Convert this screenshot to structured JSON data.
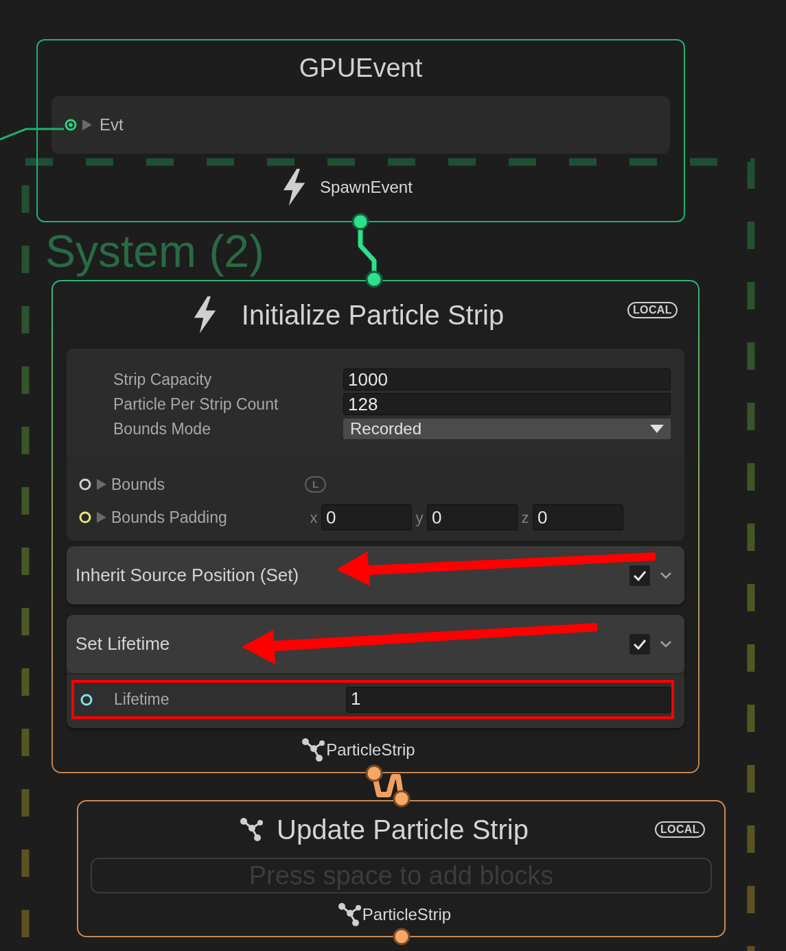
{
  "system": {
    "title": "System (2)"
  },
  "gpu_event": {
    "title": "GPUEvent",
    "ports": [
      {
        "label": "Evt",
        "color": "#2bd47f"
      }
    ],
    "output": "SpawnEvent"
  },
  "initialize": {
    "title": "Initialize Particle Strip",
    "badge": "LOCAL",
    "settings": [
      {
        "label": "Strip Capacity",
        "value": "1000",
        "kind": "number"
      },
      {
        "label": "Particle Per Strip Count",
        "value": "128",
        "kind": "number"
      },
      {
        "label": "Bounds Mode",
        "value": "Recorded",
        "kind": "dropdown"
      }
    ],
    "inputs": [
      {
        "label": "Bounds",
        "color": "#d0d0d0",
        "space_badge": "L"
      },
      {
        "label": "Bounds Padding",
        "color": "#e6e67a",
        "fields": [
          {
            "axis": "x",
            "value": "0"
          },
          {
            "axis": "y",
            "value": "0"
          },
          {
            "axis": "z",
            "value": "0"
          }
        ]
      }
    ],
    "blocks": [
      {
        "title": "Inherit Source Position (Set)",
        "enabled": true,
        "marked": true
      },
      {
        "title": "Set Lifetime",
        "enabled": true,
        "marked": true,
        "properties": [
          {
            "label": "Lifetime",
            "value": "1",
            "color": "#7de3e8",
            "highlighted": true
          }
        ]
      }
    ],
    "output": "ParticleStrip"
  },
  "update": {
    "title": "Update Particle Strip",
    "badge": "LOCAL",
    "placeholder": "Press space to add blocks",
    "output": "ParticleStrip"
  }
}
